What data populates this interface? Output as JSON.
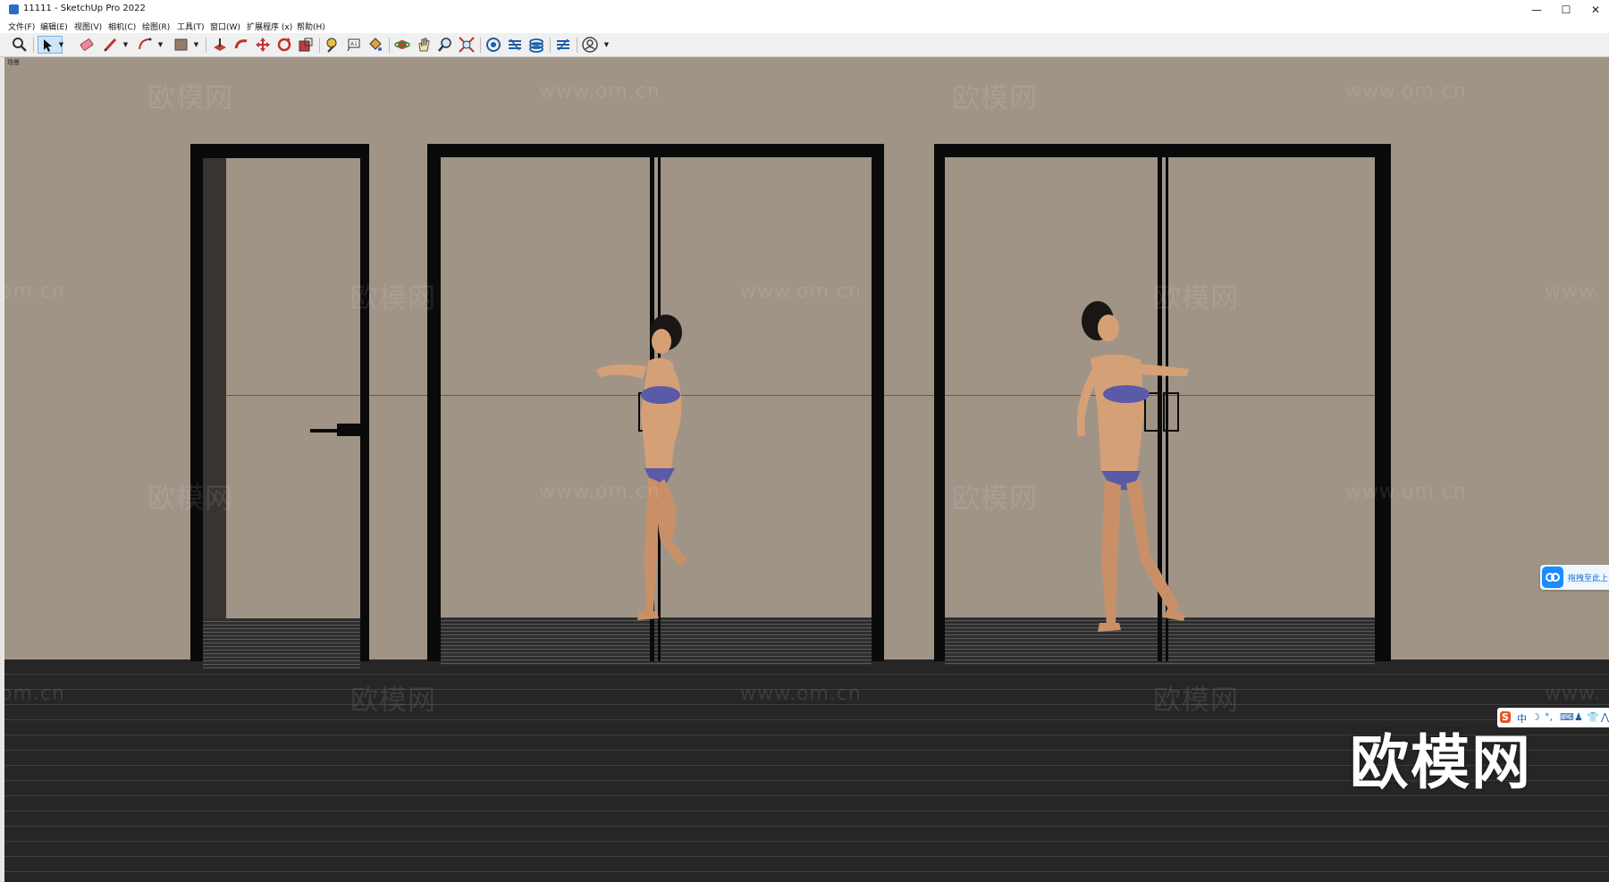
{
  "window": {
    "title": "11111 - SketchUp Pro 2022",
    "controls": [
      "—",
      "☐",
      "✕"
    ]
  },
  "menu": [
    "文件(F)",
    "编辑(E)",
    "视图(V)",
    "相机(C)",
    "绘图(R)",
    "工具(T)",
    "窗口(W)",
    "扩展程序 (x)",
    "帮助(H)"
  ],
  "toolbar": {
    "tools": [
      {
        "name": "zoom",
        "icon": "magnifier-icon"
      },
      {
        "name": "select",
        "icon": "arrow-cursor-icon",
        "active": true
      },
      {
        "name": "eraser",
        "icon": "eraser-icon"
      },
      {
        "name": "line",
        "icon": "pencil-icon"
      },
      {
        "name": "arc",
        "icon": "arc-icon"
      },
      {
        "name": "rectangle",
        "icon": "shape-icon"
      },
      {
        "name": "push-pull",
        "icon": "push-pull-icon"
      },
      {
        "name": "follow-me",
        "icon": "follow-me-icon"
      },
      {
        "name": "move",
        "icon": "move-icon"
      },
      {
        "name": "rotate",
        "icon": "rotate-icon"
      },
      {
        "name": "scale",
        "icon": "scale-icon"
      },
      {
        "name": "tape-measure",
        "icon": "tape-measure-icon"
      },
      {
        "name": "text",
        "icon": "text-icon"
      },
      {
        "name": "paint-bucket",
        "icon": "paint-bucket-icon"
      },
      {
        "name": "orbit",
        "icon": "orbit-icon"
      },
      {
        "name": "pan",
        "icon": "pan-hand-icon"
      },
      {
        "name": "zoom-2",
        "icon": "zoom-icon"
      },
      {
        "name": "zoom-extents",
        "icon": "zoom-extents-icon"
      },
      {
        "name": "warehouse",
        "icon": "warehouse-icon"
      },
      {
        "name": "extension-1",
        "icon": "extension-icon"
      },
      {
        "name": "extension-2",
        "icon": "layers-icon"
      },
      {
        "name": "extension-3",
        "icon": "extension-icon"
      },
      {
        "name": "account",
        "icon": "user-account-icon"
      }
    ]
  },
  "viewport": {
    "scene_label": "场景",
    "watermark_text": "欧模网",
    "watermark_url": "www.om.cn",
    "url_partial_left": "om.cn",
    "url_partial_right": "www.",
    "brand_watermark": "欧模网"
  },
  "overlays": {
    "cloud_button_label": "拖拽至此上",
    "ime_items": [
      "S",
      "中",
      "☽",
      "°,",
      "⌨",
      "♟",
      "👕",
      "⋀"
    ]
  },
  "colors": {
    "wall": "#a09487",
    "ground": "#262626",
    "frame": "#0a0a0a",
    "axis_red": "#b03a30",
    "active_tool": "#cde4fb"
  }
}
